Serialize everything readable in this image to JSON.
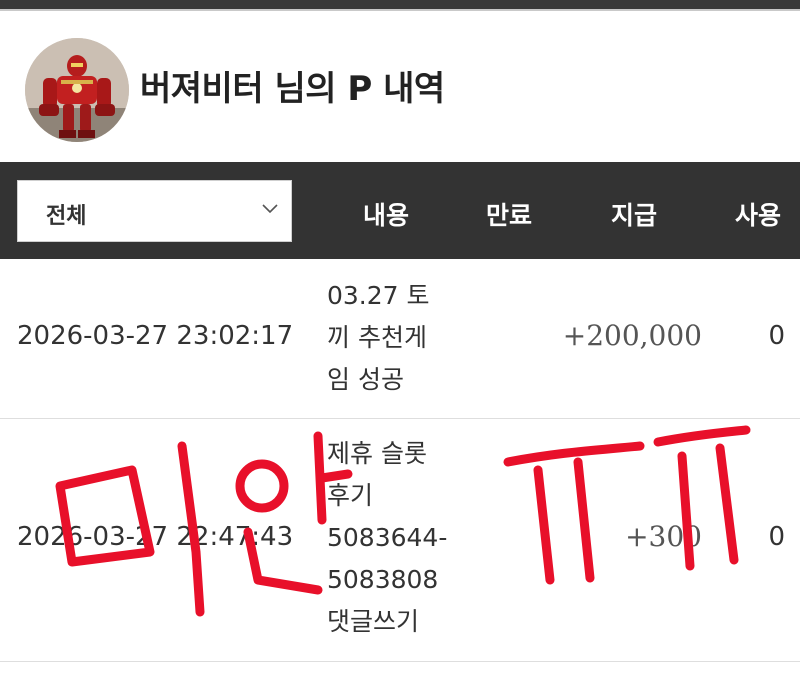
{
  "profile": {
    "title": "버져비터 님의 P 내역"
  },
  "filter": {
    "selected": "전체"
  },
  "columns": {
    "content": "내용",
    "expiry": "만료",
    "paid": "지급",
    "used": "사용"
  },
  "rows": [
    {
      "date": "2026-03-27 23:02:17",
      "content_lines": [
        "03.27 토",
        "끼 추천게",
        "임 성공"
      ],
      "amount": "+200,000",
      "used": "0"
    },
    {
      "date": "2026-03-27 22:47:43",
      "content_lines": [
        "제휴 슬롯",
        "후기",
        "5083644-",
        "5083808",
        "댓글쓰기"
      ],
      "amount": "+300",
      "used": "0"
    }
  ],
  "colors": {
    "header_bg": "#333333",
    "scribble_red": "#e8102a"
  }
}
